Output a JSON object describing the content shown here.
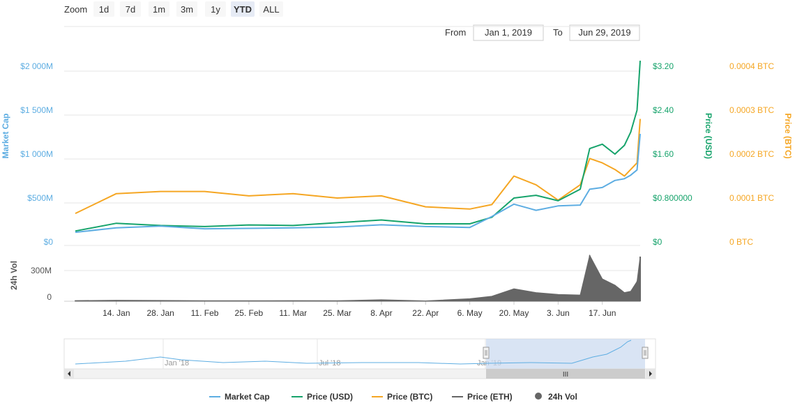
{
  "toolbar": {
    "zoom_label": "Zoom",
    "zoom_buttons": [
      "1d",
      "7d",
      "1m",
      "3m",
      "1y",
      "YTD",
      "ALL"
    ],
    "selected": "YTD",
    "from_label": "From",
    "from_value": "Jan 1, 2019",
    "to_label": "To",
    "to_value": "Jun 29, 2019"
  },
  "axes": {
    "left_title": "Market Cap",
    "left_ticks": [
      "$0",
      "$500M",
      "$1 000M",
      "$1 500M",
      "$2 000M"
    ],
    "usd_title": "Price (USD)",
    "usd_ticks": [
      "$0",
      "$0.800000",
      "$1.60",
      "$2.40",
      "$3.20"
    ],
    "btc_title": "Price (BTC)",
    "btc_ticks": [
      "0 BTC",
      "0.0001 BTC",
      "0.0002 BTC",
      "0.0003 BTC",
      "0.0004 BTC"
    ],
    "vol_title": "24h Vol",
    "vol_ticks": [
      "0",
      "300M"
    ],
    "x_ticks": [
      "14. Jan",
      "28. Jan",
      "11. Feb",
      "25. Feb",
      "11. Mar",
      "25. Mar",
      "8. Apr",
      "22. Apr",
      "6. May",
      "20. May",
      "3. Jun",
      "17. Jun"
    ]
  },
  "navigator": {
    "labels": [
      "Jan '18",
      "Jul '18",
      "Jan '19"
    ],
    "handle_glyph": "III"
  },
  "legend": [
    {
      "label": "Market Cap",
      "color": "#5dade2",
      "icon": "line"
    },
    {
      "label": "Price (USD)",
      "color": "#16a36b",
      "icon": "line"
    },
    {
      "label": "Price (BTC)",
      "color": "#f5a623",
      "icon": "line"
    },
    {
      "label": "Price (ETH)",
      "color": "#666666",
      "icon": "line"
    },
    {
      "label": "24h Vol",
      "color": "#666666",
      "icon": "dot"
    }
  ],
  "colors": {
    "market_cap": "#5dade2",
    "price_usd": "#16a36b",
    "price_btc": "#f5a623",
    "volume": "#666666",
    "selected_range": "#c9d9f0"
  },
  "chart_data": {
    "type": "line",
    "x": [
      "Jan 1",
      "Jan 14",
      "Jan 28",
      "Feb 11",
      "Feb 25",
      "Mar 11",
      "Mar 25",
      "Apr 8",
      "Apr 22",
      "May 6",
      "May 13",
      "May 20",
      "May 27",
      "Jun 3",
      "Jun 10",
      "Jun 13",
      "Jun 17",
      "Jun 21",
      "Jun 24",
      "Jun 26",
      "Jun 28",
      "Jun 29"
    ],
    "series": [
      {
        "name": "Market Cap",
        "axis": "market_cap",
        "unit": "$M",
        "values": [
          110,
          160,
          180,
          150,
          155,
          160,
          170,
          195,
          175,
          165,
          290,
          430,
          360,
          410,
          420,
          600,
          620,
          700,
          720,
          760,
          820,
          1230
        ]
      },
      {
        "name": "Price (USD)",
        "axis": "usd",
        "unit": "$",
        "values": [
          0.2,
          0.34,
          0.3,
          0.28,
          0.31,
          0.3,
          0.35,
          0.4,
          0.33,
          0.33,
          0.45,
          0.8,
          0.85,
          0.75,
          0.96,
          1.7,
          1.78,
          1.6,
          1.76,
          2.0,
          2.4,
          3.3
        ]
      },
      {
        "name": "Price (BTC)",
        "axis": "btc",
        "unit": "BTC",
        "values": [
          6.5e-05,
          0.00011,
          0.000115,
          0.000115,
          0.000105,
          0.00011,
          0.0001,
          0.000105,
          8e-05,
          7.5e-05,
          8.5e-05,
          0.00015,
          0.00013,
          9.5e-05,
          0.00013,
          0.00019,
          0.00018,
          0.000165,
          0.00015,
          0.000165,
          0.00018,
          0.00028
        ]
      },
      {
        "name": "24h Vol",
        "axis": "volume",
        "unit": "$",
        "values": [
          5000000,
          8000000,
          6000000,
          4000000,
          4000000,
          5000000,
          4000000,
          12000000,
          3000000,
          20000000,
          40000000,
          100000000,
          70000000,
          55000000,
          50000000,
          370000000,
          180000000,
          130000000,
          70000000,
          80000000,
          160000000,
          360000000
        ]
      }
    ],
    "ylim_market_cap": [
      0,
      2000
    ],
    "ylim_usd": [
      0,
      3.2
    ],
    "ylim_btc": [
      0,
      0.0004
    ],
    "ylim_volume": [
      0,
      450000000
    ],
    "grid": true,
    "legend_position": "bottom-center"
  }
}
